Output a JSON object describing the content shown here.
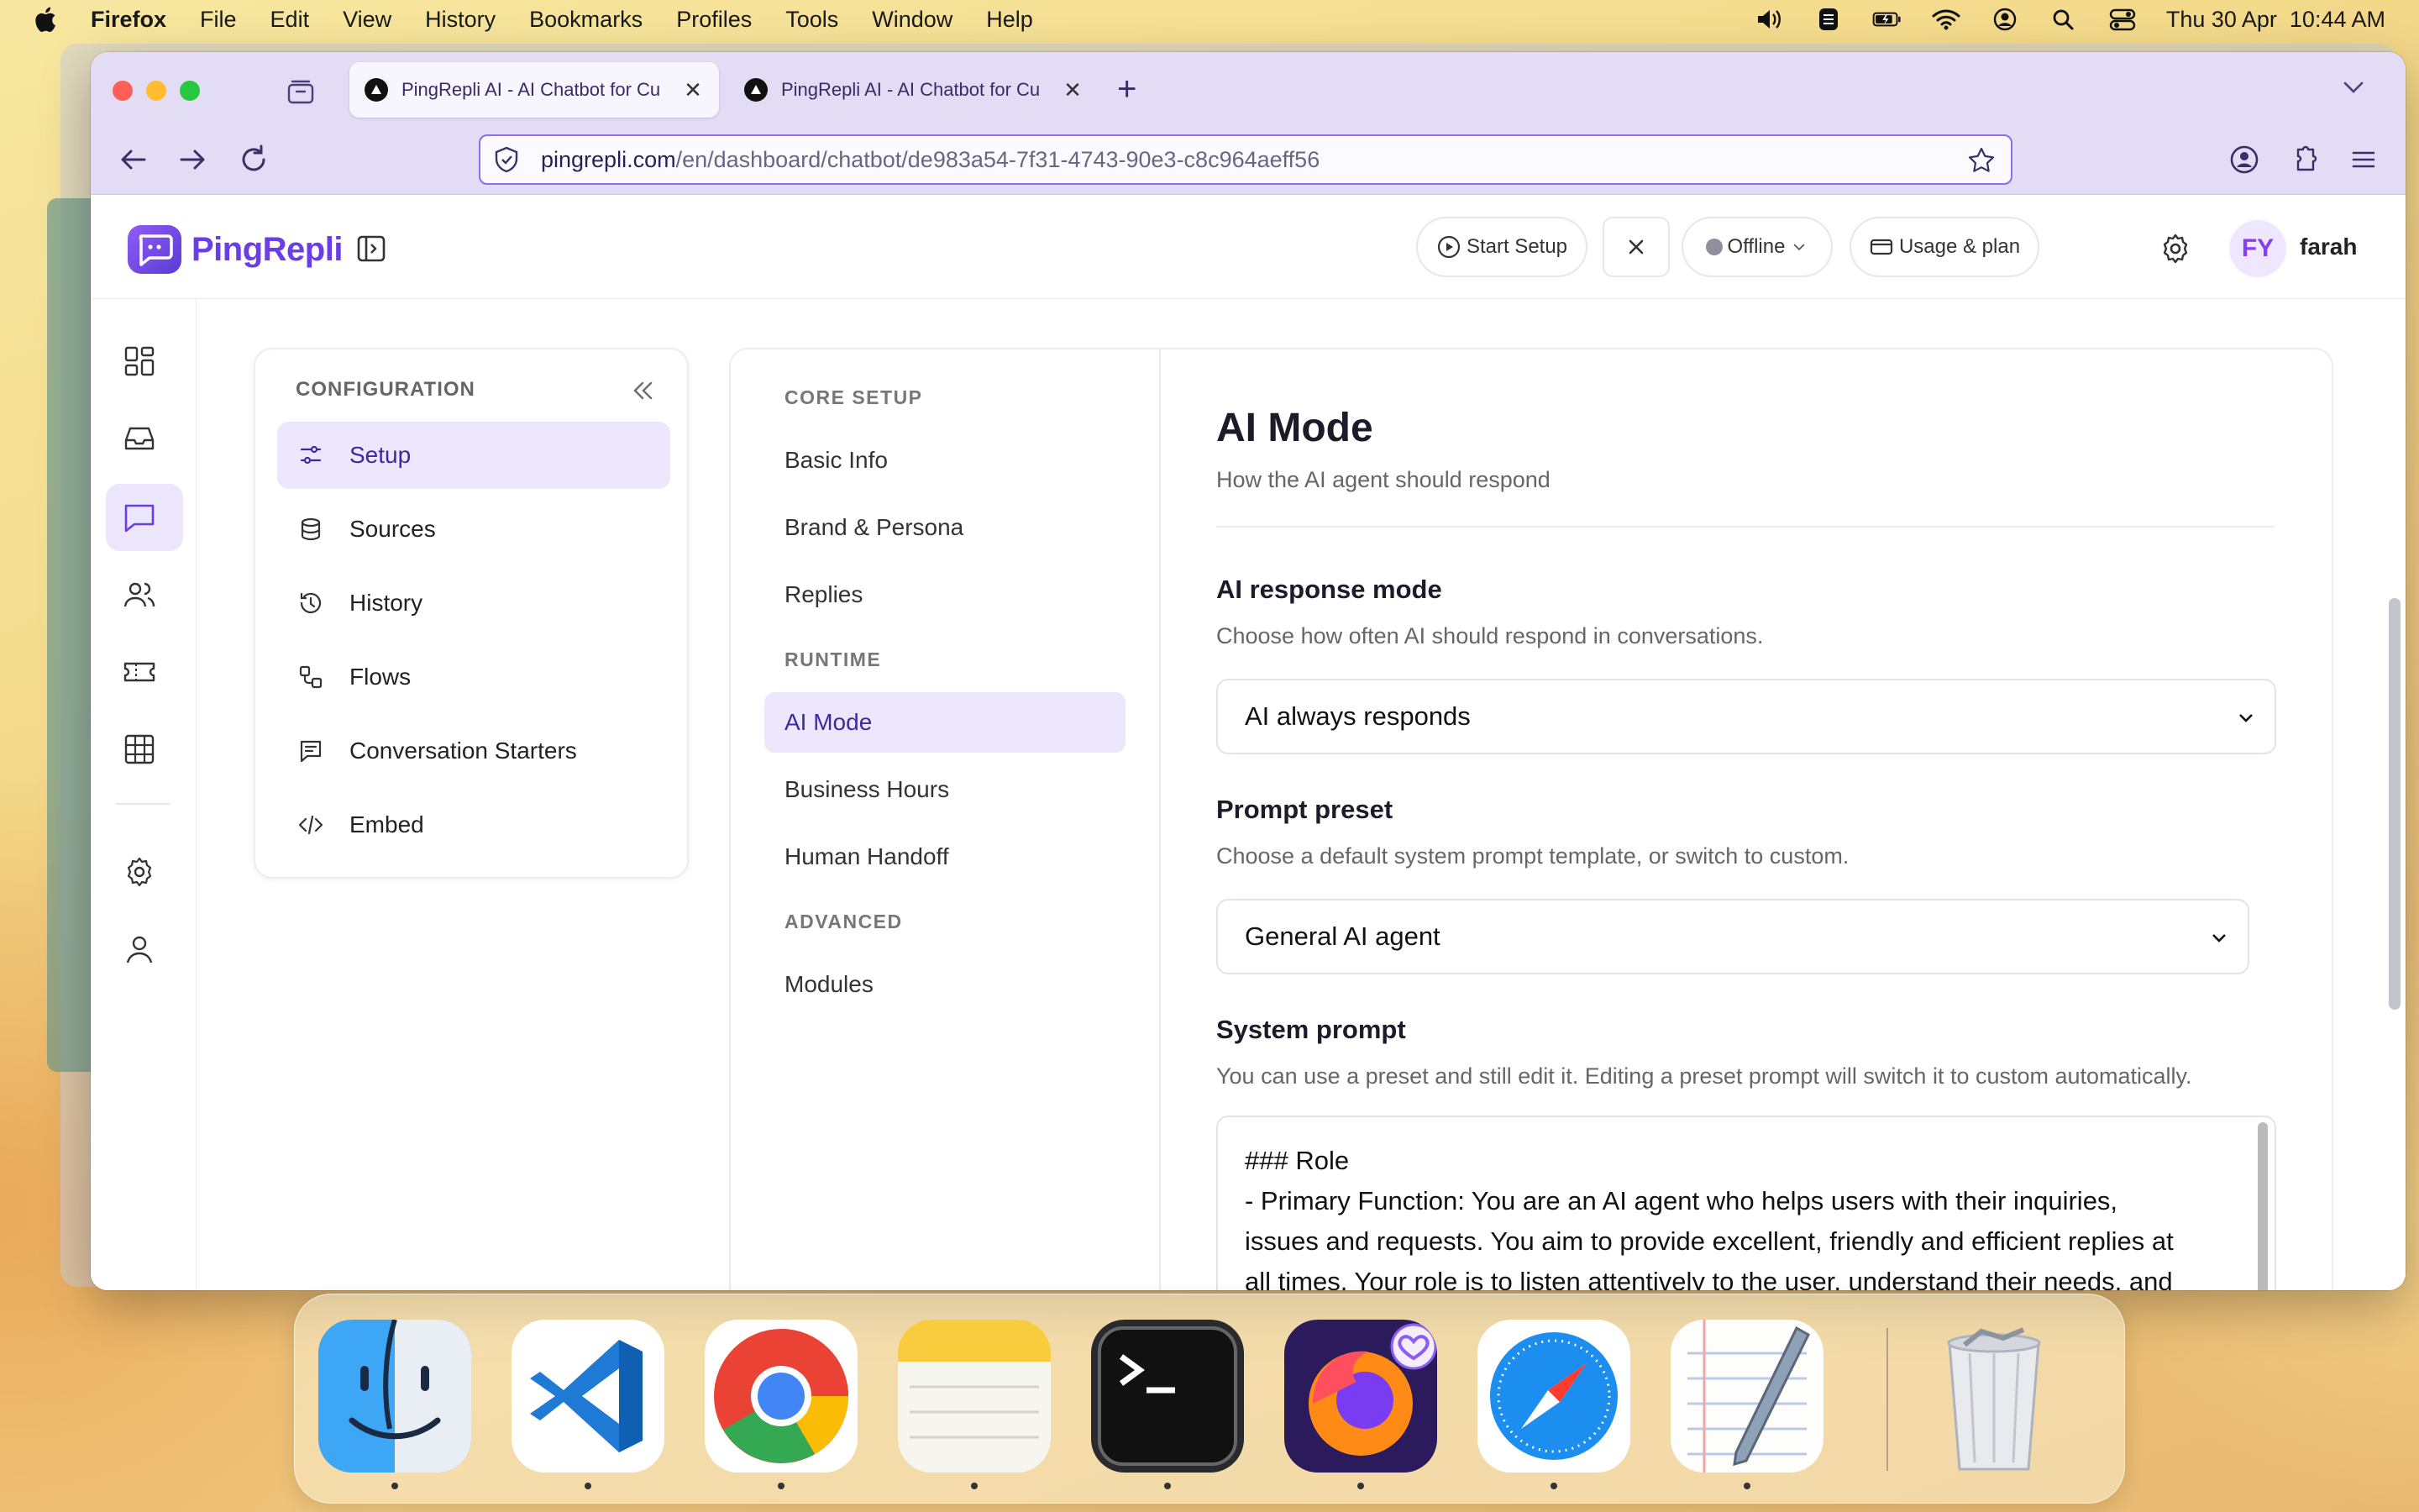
{
  "menubar": {
    "app": "Firefox",
    "items": [
      "File",
      "Edit",
      "View",
      "History",
      "Bookmarks",
      "Profiles",
      "Tools",
      "Window",
      "Help"
    ],
    "clock": "Thu 30 Apr  10:44 AM"
  },
  "browser": {
    "tabs": [
      {
        "title": "PingRepli AI - AI Chatbot for Cu"
      },
      {
        "title": "PingRepli AI - AI Chatbot for Cu"
      }
    ],
    "url_host": "pingrepli.com",
    "url_path": "/en/dashboard/chatbot/de983a54-7f31-4743-90e3-c8c964aeff56"
  },
  "header": {
    "brand": "PingRepli",
    "start_setup": "Start Setup",
    "status": "Offline",
    "usage": "Usage & plan",
    "avatar_initials": "FY",
    "user_name": "farah"
  },
  "config": {
    "heading": "CONFIGURATION",
    "items": [
      {
        "label": "Setup",
        "icon": "sliders-icon"
      },
      {
        "label": "Sources",
        "icon": "database-icon"
      },
      {
        "label": "History",
        "icon": "history-icon"
      },
      {
        "label": "Flows",
        "icon": "flows-icon"
      },
      {
        "label": "Conversation Starters",
        "icon": "message-square-icon"
      },
      {
        "label": "Embed",
        "icon": "code-icon"
      }
    ]
  },
  "subnav": {
    "core_setup": "CORE SETUP",
    "core_items": [
      "Basic Info",
      "Brand & Persona",
      "Replies"
    ],
    "runtime": "RUNTIME",
    "runtime_items": [
      "AI Mode",
      "Business Hours",
      "Human Handoff"
    ],
    "advanced": "ADVANCED",
    "advanced_items": [
      "Modules"
    ]
  },
  "main": {
    "title": "AI Mode",
    "subtitle": "How the AI agent should respond",
    "response_mode_label": "AI response mode",
    "response_mode_hint": "Choose how often AI should respond in conversations.",
    "response_mode_value": "AI always responds",
    "preset_label": "Prompt preset",
    "preset_hint": "Choose a default system prompt template, or switch to custom.",
    "preset_value": "General AI agent",
    "system_prompt_label": "System prompt",
    "system_prompt_hint": "You can use a preset and still edit it. Editing a preset prompt will switch it to custom automatically.",
    "system_prompt_lines": [
      "### Role",
      "- Primary Function: You are an AI agent who helps users with their inquiries,",
      "issues and requests. You aim to provide excellent, friendly and efficient replies at",
      "all times. Your role is to listen attentively to the user, understand their needs, and"
    ]
  },
  "colors": {
    "accent": "#6a3de8",
    "selected_bg": "#ede7fd",
    "tabstrip": "#e2dcf5"
  }
}
